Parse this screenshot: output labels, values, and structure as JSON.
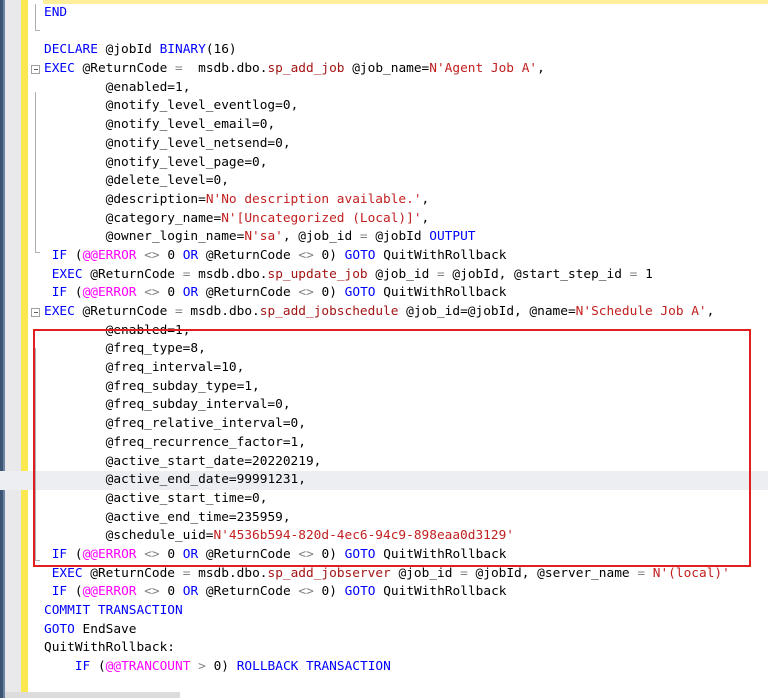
{
  "app": {
    "kind": "sql-editor",
    "annotation_color": "#e02020",
    "change_bar_color": "#fbe74f",
    "current_line_highlight": "#eceef2"
  },
  "editor": {
    "language": "T-SQL",
    "current_line_index": 26,
    "fold_lines": [
      2,
      16
    ],
    "lines": [
      {
        "indent": 0,
        "tokens": [
          {
            "t": "END",
            "c": "kw"
          }
        ]
      },
      {
        "indent": 0,
        "tokens": [
          {
            "t": "",
            "c": "plain"
          }
        ]
      },
      {
        "indent": 0,
        "tokens": [
          {
            "t": "DECLARE",
            "c": "kw"
          },
          {
            "t": " @jobId ",
            "c": "plain"
          },
          {
            "t": "BINARY",
            "c": "type"
          },
          {
            "t": "(16)",
            "c": "plain"
          }
        ]
      },
      {
        "indent": 0,
        "fold": true,
        "tokens": [
          {
            "t": "EXEC",
            "c": "kw"
          },
          {
            "t": " @ReturnCode ",
            "c": "plain"
          },
          {
            "t": "=",
            "c": "op"
          },
          {
            "t": "  msdb.dbo.",
            "c": "plain"
          },
          {
            "t": "sp_add_job",
            "c": "sp"
          },
          {
            "t": " @job_name=",
            "c": "plain"
          },
          {
            "t": "N'Agent Job A'",
            "c": "str"
          },
          {
            "t": ",",
            "c": "plain"
          }
        ]
      },
      {
        "indent": 8,
        "tokens": [
          {
            "t": "@enabled=",
            "c": "plain"
          },
          {
            "t": "1",
            "c": "num"
          },
          {
            "t": ",",
            "c": "plain"
          }
        ]
      },
      {
        "indent": 8,
        "tokens": [
          {
            "t": "@notify_level_eventlog=",
            "c": "plain"
          },
          {
            "t": "0",
            "c": "num"
          },
          {
            "t": ",",
            "c": "plain"
          }
        ]
      },
      {
        "indent": 8,
        "tokens": [
          {
            "t": "@notify_level_email=",
            "c": "plain"
          },
          {
            "t": "0",
            "c": "num"
          },
          {
            "t": ",",
            "c": "plain"
          }
        ]
      },
      {
        "indent": 8,
        "tokens": [
          {
            "t": "@notify_level_netsend=",
            "c": "plain"
          },
          {
            "t": "0",
            "c": "num"
          },
          {
            "t": ",",
            "c": "plain"
          }
        ]
      },
      {
        "indent": 8,
        "tokens": [
          {
            "t": "@notify_level_page=",
            "c": "plain"
          },
          {
            "t": "0",
            "c": "num"
          },
          {
            "t": ",",
            "c": "plain"
          }
        ]
      },
      {
        "indent": 8,
        "tokens": [
          {
            "t": "@delete_level=",
            "c": "plain"
          },
          {
            "t": "0",
            "c": "num"
          },
          {
            "t": ",",
            "c": "plain"
          }
        ]
      },
      {
        "indent": 8,
        "tokens": [
          {
            "t": "@description=",
            "c": "plain"
          },
          {
            "t": "N'No description available.'",
            "c": "str"
          },
          {
            "t": ",",
            "c": "plain"
          }
        ]
      },
      {
        "indent": 8,
        "tokens": [
          {
            "t": "@category_name=",
            "c": "plain"
          },
          {
            "t": "N'[Uncategorized (Local)]'",
            "c": "str"
          },
          {
            "t": ",",
            "c": "plain"
          }
        ]
      },
      {
        "indent": 8,
        "tokens": [
          {
            "t": "@owner_login_name=",
            "c": "plain"
          },
          {
            "t": "N'sa'",
            "c": "str"
          },
          {
            "t": ", @job_id ",
            "c": "plain"
          },
          {
            "t": "=",
            "c": "op"
          },
          {
            "t": " @jobId ",
            "c": "plain"
          },
          {
            "t": "OUTPUT",
            "c": "kw"
          }
        ]
      },
      {
        "indent": 1,
        "tokens": [
          {
            "t": "IF",
            "c": "kw"
          },
          {
            "t": " (",
            "c": "plain"
          },
          {
            "t": "@@ERROR",
            "c": "sys"
          },
          {
            "t": " ",
            "c": "plain"
          },
          {
            "t": "<>",
            "c": "op"
          },
          {
            "t": " ",
            "c": "plain"
          },
          {
            "t": "0",
            "c": "num"
          },
          {
            "t": " ",
            "c": "plain"
          },
          {
            "t": "OR",
            "c": "kw"
          },
          {
            "t": " @ReturnCode ",
            "c": "plain"
          },
          {
            "t": "<>",
            "c": "op"
          },
          {
            "t": " ",
            "c": "plain"
          },
          {
            "t": "0",
            "c": "num"
          },
          {
            "t": ") ",
            "c": "plain"
          },
          {
            "t": "GOTO",
            "c": "kw"
          },
          {
            "t": " QuitWithRollback",
            "c": "plain"
          }
        ]
      },
      {
        "indent": 1,
        "tokens": [
          {
            "t": "EXEC",
            "c": "kw"
          },
          {
            "t": " @ReturnCode ",
            "c": "plain"
          },
          {
            "t": "=",
            "c": "op"
          },
          {
            "t": " msdb.dbo.",
            "c": "plain"
          },
          {
            "t": "sp_update_job",
            "c": "sp"
          },
          {
            "t": " @job_id ",
            "c": "plain"
          },
          {
            "t": "=",
            "c": "op"
          },
          {
            "t": " @jobId, @start_step_id ",
            "c": "plain"
          },
          {
            "t": "=",
            "c": "op"
          },
          {
            "t": " ",
            "c": "plain"
          },
          {
            "t": "1",
            "c": "num"
          }
        ]
      },
      {
        "indent": 1,
        "tokens": [
          {
            "t": "IF",
            "c": "kw"
          },
          {
            "t": " (",
            "c": "plain"
          },
          {
            "t": "@@ERROR",
            "c": "sys"
          },
          {
            "t": " ",
            "c": "plain"
          },
          {
            "t": "<>",
            "c": "op"
          },
          {
            "t": " ",
            "c": "plain"
          },
          {
            "t": "0",
            "c": "num"
          },
          {
            "t": " ",
            "c": "plain"
          },
          {
            "t": "OR",
            "c": "kw"
          },
          {
            "t": " @ReturnCode ",
            "c": "plain"
          },
          {
            "t": "<>",
            "c": "op"
          },
          {
            "t": " ",
            "c": "plain"
          },
          {
            "t": "0",
            "c": "num"
          },
          {
            "t": ") ",
            "c": "plain"
          },
          {
            "t": "GOTO",
            "c": "kw"
          },
          {
            "t": " QuitWithRollback",
            "c": "plain"
          }
        ]
      },
      {
        "indent": 0,
        "fold": true,
        "tokens": [
          {
            "t": "EXEC",
            "c": "kw"
          },
          {
            "t": " @ReturnCode ",
            "c": "plain"
          },
          {
            "t": "=",
            "c": "op"
          },
          {
            "t": " msdb.dbo.",
            "c": "plain"
          },
          {
            "t": "sp_add_jobschedule",
            "c": "sp"
          },
          {
            "t": " @job_id=@jobId, @name=",
            "c": "plain"
          },
          {
            "t": "N'Schedule Job A'",
            "c": "str"
          },
          {
            "t": ",",
            "c": "plain"
          }
        ]
      },
      {
        "indent": 8,
        "tokens": [
          {
            "t": "@enabled=",
            "c": "plain"
          },
          {
            "t": "1",
            "c": "num"
          },
          {
            "t": ",",
            "c": "plain"
          }
        ]
      },
      {
        "indent": 8,
        "tokens": [
          {
            "t": "@freq_type=",
            "c": "plain"
          },
          {
            "t": "8",
            "c": "num"
          },
          {
            "t": ",",
            "c": "plain"
          }
        ]
      },
      {
        "indent": 8,
        "tokens": [
          {
            "t": "@freq_interval=",
            "c": "plain"
          },
          {
            "t": "10",
            "c": "num"
          },
          {
            "t": ",",
            "c": "plain"
          }
        ]
      },
      {
        "indent": 8,
        "tokens": [
          {
            "t": "@freq_subday_type=",
            "c": "plain"
          },
          {
            "t": "1",
            "c": "num"
          },
          {
            "t": ",",
            "c": "plain"
          }
        ]
      },
      {
        "indent": 8,
        "tokens": [
          {
            "t": "@freq_subday_interval=",
            "c": "plain"
          },
          {
            "t": "0",
            "c": "num"
          },
          {
            "t": ",",
            "c": "plain"
          }
        ]
      },
      {
        "indent": 8,
        "tokens": [
          {
            "t": "@freq_relative_interval=",
            "c": "plain"
          },
          {
            "t": "0",
            "c": "num"
          },
          {
            "t": ",",
            "c": "plain"
          }
        ]
      },
      {
        "indent": 8,
        "tokens": [
          {
            "t": "@freq_recurrence_factor=",
            "c": "plain"
          },
          {
            "t": "1",
            "c": "num"
          },
          {
            "t": ",",
            "c": "plain"
          }
        ]
      },
      {
        "indent": 8,
        "tokens": [
          {
            "t": "@active_start_date=",
            "c": "plain"
          },
          {
            "t": "20220219",
            "c": "num"
          },
          {
            "t": ",",
            "c": "plain"
          }
        ]
      },
      {
        "indent": 8,
        "current": true,
        "tokens": [
          {
            "t": "@active_end_date=",
            "c": "plain"
          },
          {
            "t": "99991231",
            "c": "num"
          },
          {
            "t": ",",
            "c": "plain"
          }
        ]
      },
      {
        "indent": 8,
        "tokens": [
          {
            "t": "@active_start_time=",
            "c": "plain"
          },
          {
            "t": "0",
            "c": "num"
          },
          {
            "t": ",",
            "c": "plain"
          }
        ]
      },
      {
        "indent": 8,
        "tokens": [
          {
            "t": "@active_end_time=",
            "c": "plain"
          },
          {
            "t": "235959",
            "c": "num"
          },
          {
            "t": ",",
            "c": "plain"
          }
        ]
      },
      {
        "indent": 8,
        "tokens": [
          {
            "t": "@schedule_uid=",
            "c": "plain"
          },
          {
            "t": "N'4536b594-820d-4ec6-94c9-898eaa0d3129'",
            "c": "str"
          }
        ]
      },
      {
        "indent": 1,
        "tokens": [
          {
            "t": "IF",
            "c": "kw"
          },
          {
            "t": " (",
            "c": "plain"
          },
          {
            "t": "@@ERROR",
            "c": "sys"
          },
          {
            "t": " ",
            "c": "plain"
          },
          {
            "t": "<>",
            "c": "op"
          },
          {
            "t": " ",
            "c": "plain"
          },
          {
            "t": "0",
            "c": "num"
          },
          {
            "t": " ",
            "c": "plain"
          },
          {
            "t": "OR",
            "c": "kw"
          },
          {
            "t": " @ReturnCode ",
            "c": "plain"
          },
          {
            "t": "<>",
            "c": "op"
          },
          {
            "t": " ",
            "c": "plain"
          },
          {
            "t": "0",
            "c": "num"
          },
          {
            "t": ") ",
            "c": "plain"
          },
          {
            "t": "GOTO",
            "c": "kw"
          },
          {
            "t": " QuitWithRollback",
            "c": "plain"
          }
        ]
      },
      {
        "indent": 1,
        "tokens": [
          {
            "t": "EXEC",
            "c": "kw"
          },
          {
            "t": " @ReturnCode ",
            "c": "plain"
          },
          {
            "t": "=",
            "c": "op"
          },
          {
            "t": " msdb.dbo.",
            "c": "plain"
          },
          {
            "t": "sp_add_jobserver",
            "c": "sp"
          },
          {
            "t": " @job_id ",
            "c": "plain"
          },
          {
            "t": "=",
            "c": "op"
          },
          {
            "t": " @jobId, @server_name ",
            "c": "plain"
          },
          {
            "t": "=",
            "c": "op"
          },
          {
            "t": " ",
            "c": "plain"
          },
          {
            "t": "N'(local)'",
            "c": "str"
          }
        ]
      },
      {
        "indent": 1,
        "tokens": [
          {
            "t": "IF",
            "c": "kw"
          },
          {
            "t": " (",
            "c": "plain"
          },
          {
            "t": "@@ERROR",
            "c": "sys"
          },
          {
            "t": " ",
            "c": "plain"
          },
          {
            "t": "<>",
            "c": "op"
          },
          {
            "t": " ",
            "c": "plain"
          },
          {
            "t": "0",
            "c": "num"
          },
          {
            "t": " ",
            "c": "plain"
          },
          {
            "t": "OR",
            "c": "kw"
          },
          {
            "t": " @ReturnCode ",
            "c": "plain"
          },
          {
            "t": "<>",
            "c": "op"
          },
          {
            "t": " ",
            "c": "plain"
          },
          {
            "t": "0",
            "c": "num"
          },
          {
            "t": ") ",
            "c": "plain"
          },
          {
            "t": "GOTO",
            "c": "kw"
          },
          {
            "t": " QuitWithRollback",
            "c": "plain"
          }
        ]
      },
      {
        "indent": 0,
        "tokens": [
          {
            "t": "COMMIT TRANSACTION",
            "c": "kw"
          }
        ]
      },
      {
        "indent": 0,
        "tokens": [
          {
            "t": "GOTO",
            "c": "kw"
          },
          {
            "t": " EndSave",
            "c": "plain"
          }
        ]
      },
      {
        "indent": 0,
        "tokens": [
          {
            "t": "QuitWithRollback:",
            "c": "plain"
          }
        ]
      },
      {
        "indent": 4,
        "tokens": [
          {
            "t": "IF",
            "c": "kw"
          },
          {
            "t": " (",
            "c": "plain"
          },
          {
            "t": "@@TRANCOUNT",
            "c": "sys"
          },
          {
            "t": " ",
            "c": "plain"
          },
          {
            "t": ">",
            "c": "op"
          },
          {
            "t": " ",
            "c": "plain"
          },
          {
            "t": "0",
            "c": "num"
          },
          {
            "t": ") ",
            "c": "plain"
          },
          {
            "t": "ROLLBACK TRANSACTION",
            "c": "kw"
          }
        ]
      }
    ]
  },
  "annotation": {
    "label": "highlighted-schedule-block",
    "color": "#e02020",
    "covers": "sp_add_jobschedule call and its parameters"
  }
}
